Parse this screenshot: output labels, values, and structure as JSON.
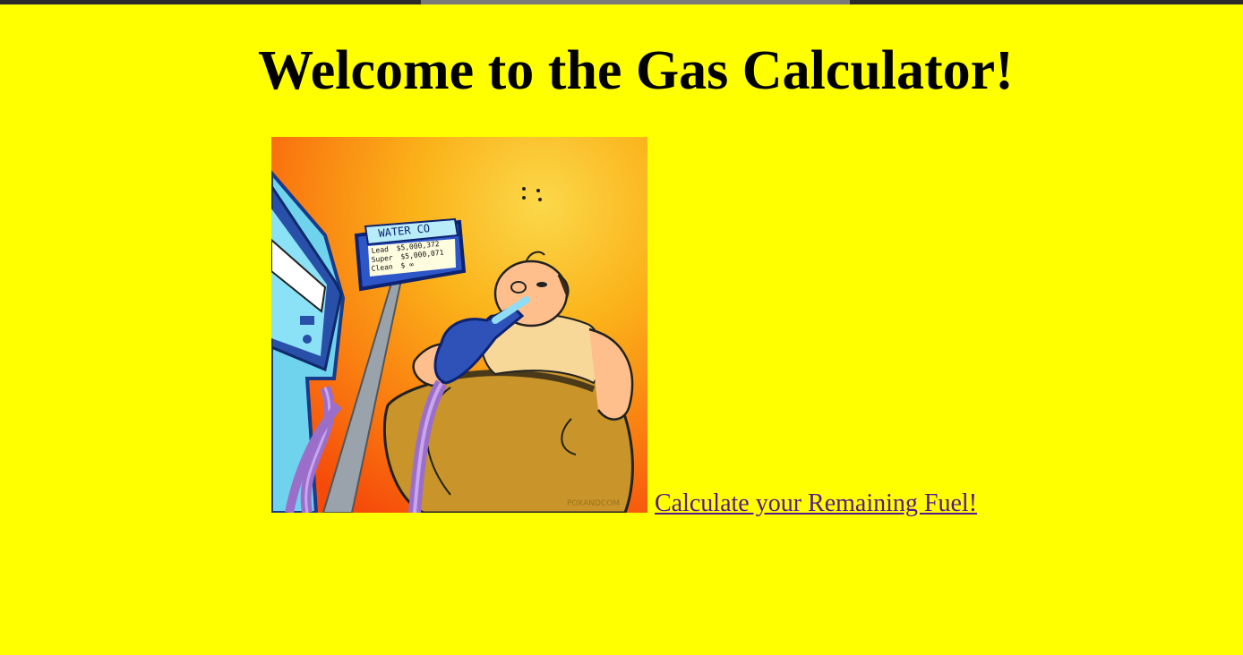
{
  "page": {
    "title": "Welcome to the Gas Calculator!",
    "background_color": "#ffff00"
  },
  "illustration": {
    "sign_brand": "WATER CO",
    "sign_rows": [
      {
        "grade": "Lead",
        "price": "$5,000,372"
      },
      {
        "grade": "Super",
        "price": "$5,000,071"
      },
      {
        "grade": "Clean",
        "price": "$ ∞"
      }
    ],
    "signature": "POXANDCOM"
  },
  "link": {
    "label": "Calculate your Remaining Fuel!",
    "color": "#551a8b"
  }
}
